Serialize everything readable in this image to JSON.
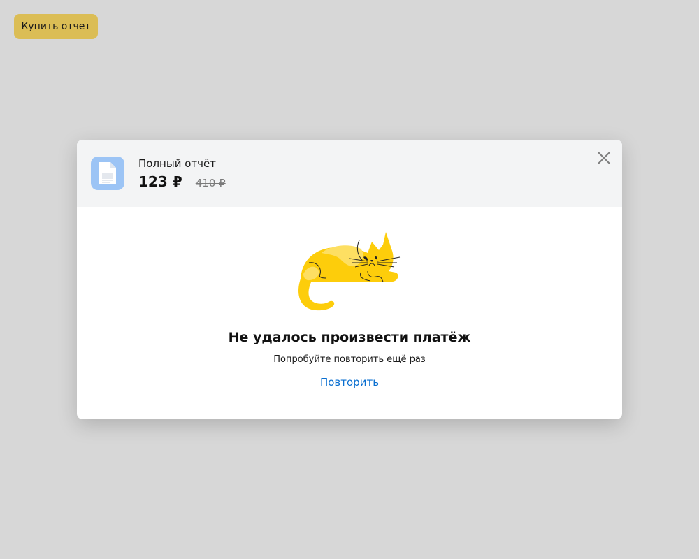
{
  "buy_button": {
    "label": "Купить отчет"
  },
  "modal": {
    "product": {
      "icon": "document-icon",
      "title": "Полный отчёт",
      "price": "123 ₽",
      "old_price": "410 ₽"
    },
    "close_icon": "close-icon",
    "illustration": "cat-illustration",
    "error": {
      "title": "Не удалось произвести платёж",
      "subtitle": "Попробуйте повторить ещё раз",
      "retry_label": "Повторить"
    }
  },
  "colors": {
    "background": "#d7d7d7",
    "buy_button": "#dbbd55",
    "header_bg": "#f3f4f5",
    "icon_bg": "#9cc4f5",
    "link": "#0a6fd0",
    "cat_yellow": "#fdcd0b",
    "cat_light": "#fddf62"
  }
}
